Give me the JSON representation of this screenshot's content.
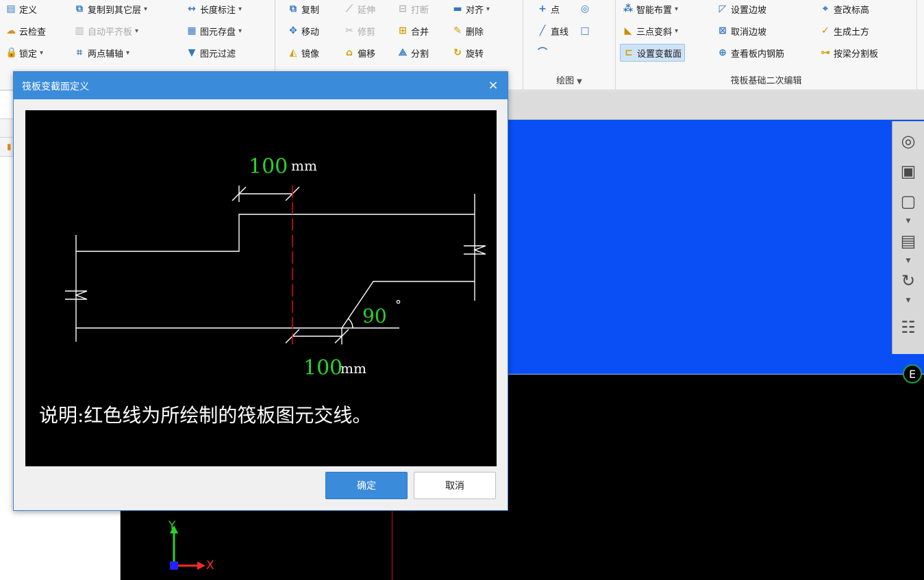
{
  "ribbon": {
    "groups": [
      {
        "name": "modify-group-1",
        "rows": [
          [
            {
              "label": "定义",
              "icon": "define-icon"
            },
            {
              "label": "复制到其它层",
              "icon": "copy-to-layer-icon",
              "dropdown": true
            },
            {
              "label": "长度标注",
              "icon": "dimension-icon",
              "dropdown": true
            }
          ],
          [
            {
              "label": "云检查",
              "icon": "cloud-check-icon"
            },
            {
              "label": "自动平齐板",
              "icon": "auto-align-icon",
              "dropdown": true,
              "disabled": true
            },
            {
              "label": "图元存盘",
              "icon": "save-element-icon",
              "dropdown": true
            }
          ],
          [
            {
              "label": "锁定",
              "icon": "lock-icon",
              "dropdown": true
            },
            {
              "label": "两点辅轴",
              "icon": "aux-axis-icon",
              "dropdown": true
            },
            {
              "label": "图元过滤",
              "icon": "filter-icon"
            }
          ]
        ]
      },
      {
        "name": "modify-group-2",
        "rows": [
          [
            {
              "label": "复制",
              "icon": "copy-icon"
            },
            {
              "label": "延伸",
              "icon": "extend-icon",
              "disabled": true
            },
            {
              "label": "打断",
              "icon": "break-icon",
              "disabled": true
            },
            {
              "label": "对齐",
              "icon": "align-icon",
              "dropdown": true
            }
          ],
          [
            {
              "label": "移动",
              "icon": "move-icon"
            },
            {
              "label": "修剪",
              "icon": "trim-icon",
              "disabled": true
            },
            {
              "label": "合并",
              "icon": "merge-icon"
            },
            {
              "label": "删除",
              "icon": "delete-icon"
            }
          ],
          [
            {
              "label": "镜像",
              "icon": "mirror-icon"
            },
            {
              "label": "偏移",
              "icon": "offset-icon"
            },
            {
              "label": "分割",
              "icon": "split-icon"
            },
            {
              "label": "旋转",
              "icon": "rotate-icon"
            }
          ]
        ]
      },
      {
        "name": "draw-group",
        "title": "绘图",
        "rows": [
          [
            {
              "label": "点",
              "icon": "point-icon"
            },
            {
              "label": "",
              "icon": "circle-icon"
            }
          ],
          [
            {
              "label": "直线",
              "icon": "line-icon"
            },
            {
              "label": "",
              "icon": "rect-icon"
            }
          ],
          [
            {
              "label": "",
              "icon": "arc-icon"
            }
          ]
        ]
      },
      {
        "name": "raft-edit-group",
        "title": "筏板基础二次编辑",
        "rows": [
          [
            {
              "label": "智能布置",
              "icon": "smart-layout-icon",
              "dropdown": true
            },
            {
              "label": "设置边坡",
              "icon": "set-slope-icon"
            },
            {
              "label": "查改标高",
              "icon": "elevation-icon"
            }
          ],
          [
            {
              "label": "三点变斜",
              "icon": "three-point-slope-icon",
              "dropdown": true
            },
            {
              "label": "取消边坡",
              "icon": "cancel-slope-icon"
            },
            {
              "label": "生成土方",
              "icon": "earthwork-icon"
            }
          ],
          [
            {
              "label": "设置变截面",
              "icon": "variable-section-icon",
              "active": true
            },
            {
              "label": "查看板内钢筋",
              "icon": "view-rebar-icon"
            },
            {
              "label": "按梁分割板",
              "icon": "split-by-beam-icon"
            }
          ]
        ]
      }
    ]
  },
  "dialog": {
    "title": "筏板变截面定义",
    "close_label": "×",
    "diagram": {
      "dim_top_value": "100",
      "dim_top_unit": "mm",
      "dim_bottom_value": "100",
      "dim_bottom_unit": "mm",
      "angle_value": "90",
      "angle_unit": "°",
      "note": "说明:红色线为所绘制的筏板图元交线。"
    },
    "ok_label": "确定",
    "cancel_label": "取消"
  },
  "viewport": {
    "axis_y": "Y",
    "axis_x": "X",
    "compass": "E"
  },
  "colors": {
    "accent": "#3b8bdb",
    "viewport_blue": "#0a4ff5",
    "dim_green": "#2ad12a",
    "section_red": "#d01010"
  }
}
